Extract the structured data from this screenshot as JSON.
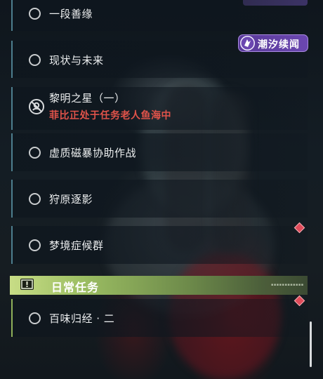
{
  "quests": {
    "items": [
      {
        "label": "一段善缘"
      },
      {
        "label": "现状与未来"
      },
      {
        "label": "黎明之星（一）",
        "status": "菲比正处于任务老人鱼海中"
      },
      {
        "label": "虚质磁暴协助作战"
      },
      {
        "label": "狩原逐影"
      },
      {
        "label": "梦境症候群"
      }
    ]
  },
  "event_tag": {
    "label": "潮汐续闻"
  },
  "daily_section": {
    "title": "日常任务",
    "items": [
      {
        "label": "百味归经 · 二"
      }
    ]
  },
  "colors": {
    "accent_teal": "#4d7e8e",
    "status_red": "#e0534a",
    "daily_green": "#9bbd62",
    "event_purple": "#6b47b0"
  }
}
